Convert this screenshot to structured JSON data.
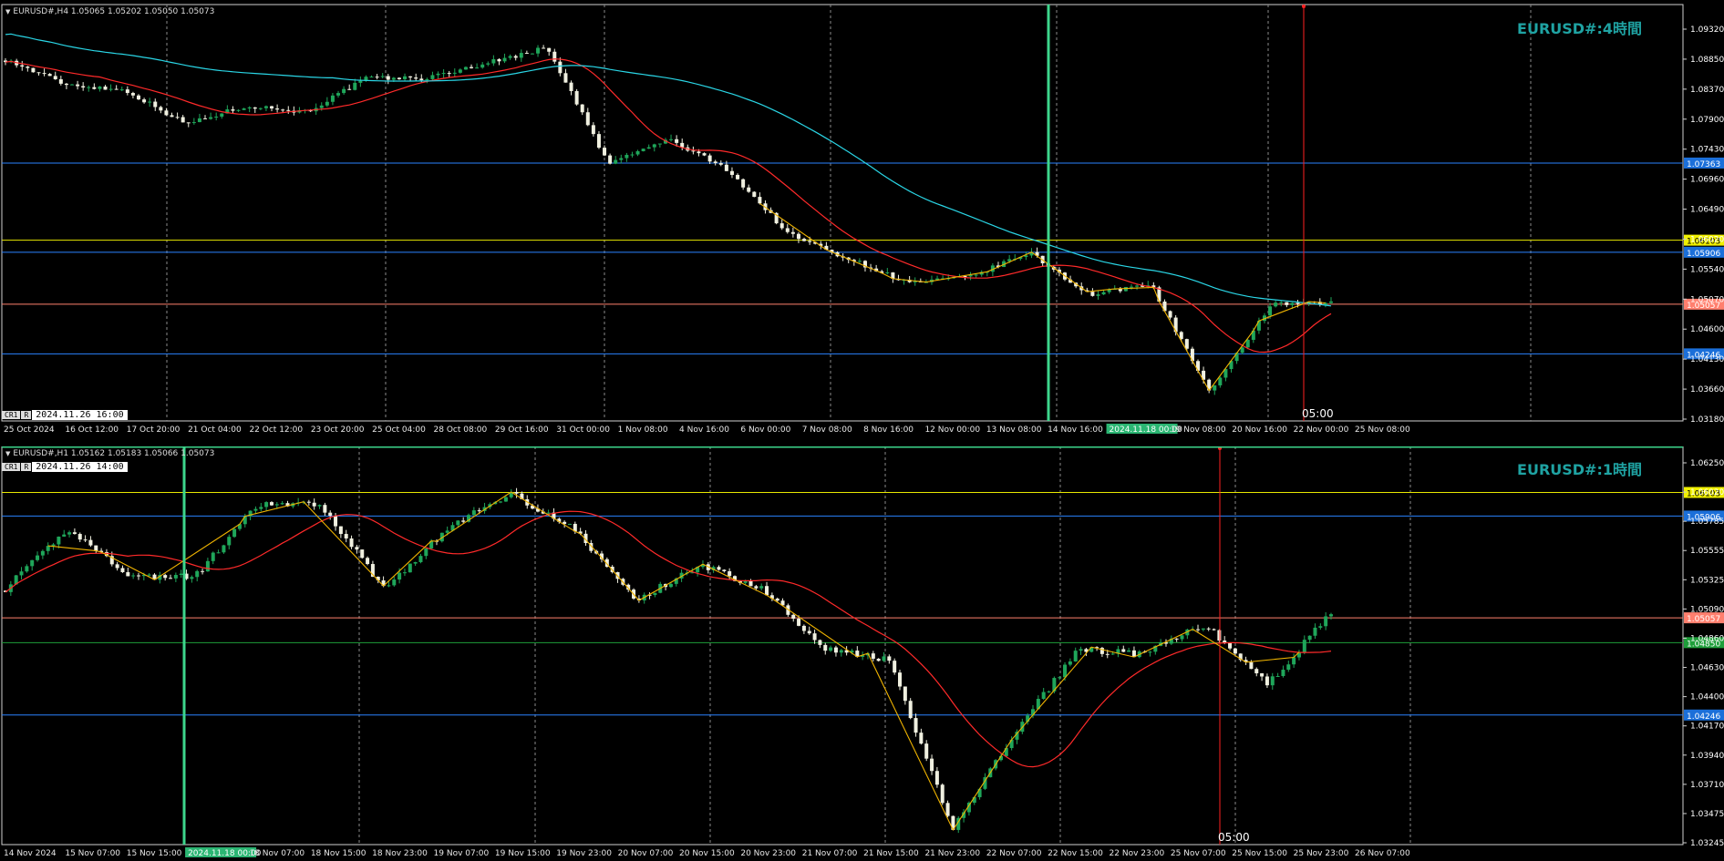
{
  "panes": [
    {
      "id": "h4",
      "info": "EURUSD#,H4  1.05065 1.05202 1.05050 1.05073",
      "watermark": "EURUSD#:4時間",
      "crosshair": {
        "keys": [
          "CR1",
          "R"
        ],
        "time": "2024.11.26 16:00"
      },
      "cursor_label": "05:00",
      "price_ticks": [
        "1.09320",
        "1.08850",
        "1.08370",
        "1.07900",
        "1.07430",
        "1.06960",
        "1.06490",
        "1.06020",
        "1.05540",
        "1.05070",
        "1.04600",
        "1.04130",
        "1.03660",
        "1.03180"
      ],
      "time_ticks": [
        "25 Oct 2024",
        "16 Oct 12:00",
        "17 Oct 20:00",
        "21 Oct 04:00",
        "22 Oct 12:00",
        "23 Oct 20:00",
        "25 Oct 04:00",
        "28 Oct 08:00",
        "29 Oct 16:00",
        "31 Oct 00:00",
        "1 Nov 08:00",
        "4 Nov 16:00",
        "6 Nov 00:00",
        "7 Nov 08:00",
        "8 Nov 16:00",
        "12 Nov 00:00",
        "13 Nov 08:00",
        "14 Nov 16:00",
        "2024.11.18 00:00",
        "19 Nov 08:00",
        "20 Nov 16:00",
        "22 Nov 00:00",
        "25 Nov 08:00"
      ],
      "hlines": [
        {
          "price": 1.07363,
          "color": "#2a82ff",
          "label": "1.07363",
          "label_bg": "#1b6fd9",
          "label_fg": "#ffffff"
        },
        {
          "price": 1.06103,
          "color": "#e8e800",
          "label": "1.06103",
          "label_bg": "#f0f000",
          "label_fg": "#000000"
        },
        {
          "price": 1.05906,
          "color": "#2a82ff",
          "label": "1.05906",
          "label_bg": "#1b6fd9",
          "label_fg": "#ffffff"
        },
        {
          "price": 1.05057,
          "color": "#ff7f6e",
          "label": "1.05057",
          "label_bg": "#ff7f6e",
          "label_fg": "#ffffff"
        },
        {
          "price": 1.04246,
          "color": "#2a82ff",
          "label": "1.04246",
          "label_bg": "#1b6fd9",
          "label_fg": "#ffffff"
        }
      ],
      "colors": {
        "bull": "#1fa65a",
        "bear": "#f0f0e0",
        "ma_fast": "#ff2a2a",
        "ma_slow": "#2ad6e6",
        "zigzag": "#f0b400",
        "vline": "#3dd68c",
        "cursor_line": "#ff2020"
      }
    },
    {
      "id": "h1",
      "info": "EURUSD#,H1  1.05162 1.05183 1.05066 1.05073",
      "watermark": "EURUSD#:1時間",
      "crosshair": {
        "keys": [
          "CR1",
          "R"
        ],
        "time": "2024.11.26 14:00"
      },
      "cursor_label": "05:00",
      "price_ticks": [
        "1.06250",
        "1.06020",
        "1.05785",
        "1.05555",
        "1.05325",
        "1.05090",
        "1.04860",
        "1.04630",
        "1.04400",
        "1.04170",
        "1.03940",
        "1.03710",
        "1.03475",
        "1.03245"
      ],
      "time_ticks": [
        "14 Nov 2024",
        "15 Nov 07:00",
        "15 Nov 15:00",
        "2024.11.18 00:00",
        "18 Nov 07:00",
        "18 Nov 15:00",
        "18 Nov 23:00",
        "19 Nov 07:00",
        "19 Nov 15:00",
        "19 Nov 23:00",
        "20 Nov 07:00",
        "20 Nov 15:00",
        "20 Nov 23:00",
        "21 Nov 07:00",
        "21 Nov 15:00",
        "21 Nov 23:00",
        "22 Nov 07:00",
        "22 Nov 15:00",
        "22 Nov 23:00",
        "25 Nov 07:00",
        "25 Nov 15:00",
        "25 Nov 23:00",
        "26 Nov 07:00"
      ],
      "hlines": [
        {
          "price": 1.06103,
          "color": "#e8e800",
          "label": "1.06103",
          "label_bg": "#f0f000",
          "label_fg": "#000000"
        },
        {
          "price": 1.05906,
          "color": "#2a82ff",
          "label": "1.05906",
          "label_bg": "#1b6fd9",
          "label_fg": "#ffffff"
        },
        {
          "price": 1.05057,
          "color": "#ff7f6e",
          "label": "1.05057",
          "label_bg": "#ff7f6e",
          "label_fg": "#ffffff"
        },
        {
          "price": 1.0485,
          "color": "#1e9e3a",
          "label": "1.04850",
          "label_bg": "#1e9e3a",
          "label_fg": "#ffffff"
        },
        {
          "price": 1.04246,
          "color": "#2a82ff",
          "label": "1.04246",
          "label_bg": "#1b6fd9",
          "label_fg": "#ffffff"
        }
      ],
      "colors": {
        "bull": "#1fa65a",
        "bear": "#f0f0e0",
        "ma_fast": "#ff2a2a",
        "zigzag": "#f0b400",
        "vline": "#3dd68c",
        "cursor_line": "#ff2020",
        "active_border": "#3dd68c"
      }
    }
  ],
  "chart_data": [
    {
      "type": "line",
      "symbol": "EURUSD#",
      "timeframe": "H4",
      "x": [
        "15 Oct",
        "17 Oct",
        "21 Oct",
        "23 Oct",
        "25 Oct",
        "29 Oct",
        "31 Oct",
        "1 Nov",
        "4 Nov",
        "5 Nov",
        "6 Nov",
        "7 Nov",
        "8 Nov",
        "12 Nov",
        "13 Nov",
        "14 Nov",
        "18 Nov",
        "19 Nov",
        "20 Nov",
        "21 Nov",
        "22 Nov",
        "25 Nov",
        "26 Nov"
      ],
      "series": [
        {
          "values": [
            1.0905,
            1.0865,
            1.0855,
            1.08,
            1.083,
            1.082,
            1.0875,
            1.0875,
            1.09,
            1.0925,
            1.0735,
            1.0775,
            1.0725,
            1.062,
            1.058,
            1.054,
            1.055,
            1.059,
            1.052,
            1.054,
            1.036,
            1.0505,
            1.0507
          ]
        }
      ],
      "ylim": [
        1.0318,
        1.0955
      ],
      "grid": true
    },
    {
      "type": "line",
      "symbol": "EURUSD#",
      "timeframe": "H1",
      "x": [
        "14 Nov",
        "15 Nov 07:00",
        "15 Nov 15:00",
        "18 Nov 07:00",
        "18 Nov 15:00",
        "18 Nov 23:00",
        "19 Nov 07:00",
        "19 Nov 15:00",
        "19 Nov 23:00",
        "20 Nov 07:00",
        "20 Nov 15:00",
        "20 Nov 23:00",
        "21 Nov 07:00",
        "21 Nov 15:00",
        "21 Nov 23:00",
        "22 Nov 07:00",
        "22 Nov 15:00",
        "22 Nov 23:00",
        "25 Nov 07:00",
        "25 Nov 15:00",
        "25 Nov 23:00",
        "26 Nov 07:00"
      ],
      "series": [
        {
          "values": [
            1.053,
            1.058,
            1.054,
            1.054,
            1.06,
            1.06,
            1.053,
            1.058,
            1.061,
            1.058,
            1.052,
            1.055,
            1.053,
            1.048,
            1.047,
            1.033,
            1.041,
            1.048,
            1.0475,
            1.05,
            1.045,
            1.051
          ]
        }
      ],
      "ylim": [
        1.0318,
        1.0635
      ],
      "grid": true
    }
  ]
}
